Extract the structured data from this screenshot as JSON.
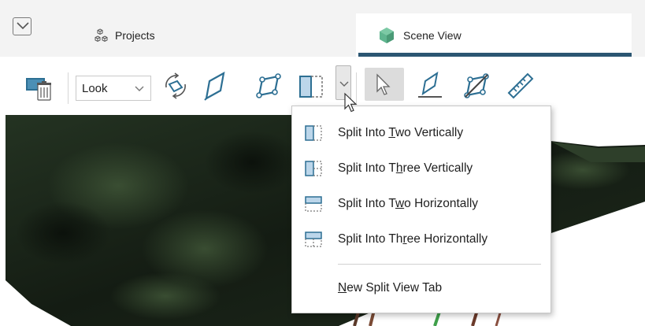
{
  "tabs": {
    "items": [
      {
        "label": "Projects",
        "icon": "projects-cubes-icon",
        "active": false
      },
      {
        "label": "Scene View",
        "icon": "scene-view-cube-icon",
        "active": true
      }
    ],
    "active_color": "#2b5672"
  },
  "toolbar": {
    "look_select": {
      "value": "Look"
    },
    "tools": [
      "clear-scene-icon",
      "rotate-view-icon",
      "draw-plane-icon",
      "rotate-plane-icon",
      "split-view-icon",
      "split-dropdown-chevron-icon",
      "select-pointer-icon",
      "draw-line-icon",
      "slice-icon",
      "ruler-icon"
    ]
  },
  "menu": {
    "items": [
      {
        "pre": "Split Into ",
        "u": "T",
        "post": "wo Vertically",
        "icon": "split-two-vertical-icon"
      },
      {
        "pre": "Split Into T",
        "u": "h",
        "post": "ree Vertically",
        "icon": "split-three-vertical-icon"
      },
      {
        "pre": "Split Into T",
        "u": "w",
        "post": "o Horizontally",
        "icon": "split-two-horizontal-icon"
      },
      {
        "pre": "Split Into Th",
        "u": "r",
        "post": "ee Horizontally",
        "icon": "split-three-horizontal-icon"
      },
      {
        "pre": "",
        "u": "N",
        "post": "ew Split View Tab",
        "icon": ""
      }
    ]
  },
  "colors": {
    "icon_blue": "#2d6f93",
    "icon_fill": "#bcd6ea",
    "scene_cube_green": "#5fb58f",
    "scene_dark": "#1b2418"
  }
}
